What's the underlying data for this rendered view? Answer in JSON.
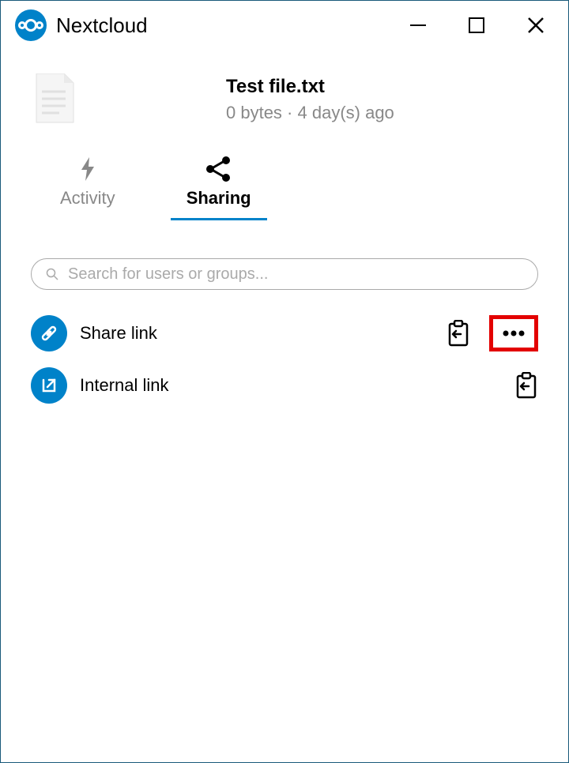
{
  "app": {
    "title": "Nextcloud"
  },
  "file": {
    "name": "Test file.txt",
    "size": "0 bytes",
    "age": "4 day(s) ago"
  },
  "tabs": {
    "activity": "Activity",
    "sharing": "Sharing"
  },
  "search": {
    "placeholder": "Search for users or groups..."
  },
  "share": {
    "shareLink": "Share link",
    "internalLink": "Internal link"
  },
  "colors": {
    "accent": "#0082c9",
    "highlight": "#e30000"
  }
}
